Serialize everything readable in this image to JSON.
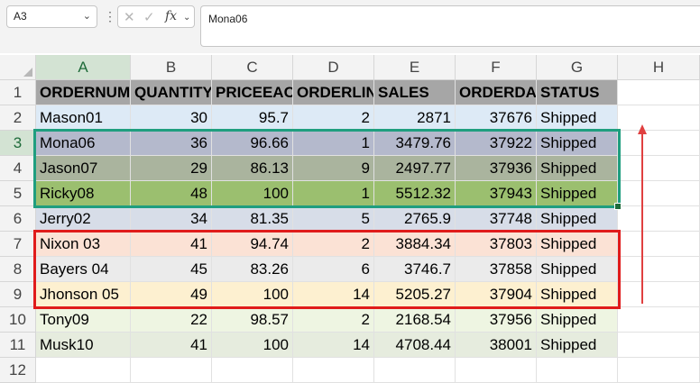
{
  "name_box": {
    "value": "A3"
  },
  "formula_bar": {
    "value": "Mona06",
    "fx_label": "fx"
  },
  "columns": [
    "A",
    "B",
    "C",
    "D",
    "E",
    "F",
    "G",
    "H"
  ],
  "rows": [
    "1",
    "2",
    "3",
    "4",
    "5",
    "6",
    "7",
    "8",
    "9",
    "10",
    "11",
    "12"
  ],
  "headers": [
    "ORDERNUM",
    "QUANTITY",
    "PRICEEAC",
    "ORDERLIN",
    "SALES",
    "ORDERDA",
    "STATUS"
  ],
  "data": [
    {
      "name": "Mason01",
      "qty": "30",
      "price": "95.7",
      "line": "2",
      "sales": "2871",
      "date": "37676",
      "status": "Shipped",
      "fill": "#ddeaf6"
    },
    {
      "name": "Mona06",
      "qty": "36",
      "price": "96.66",
      "line": "1",
      "sales": "3479.76",
      "date": "37922",
      "status": "Shipped",
      "fill": "#b4b9cc"
    },
    {
      "name": "Jason07",
      "qty": "29",
      "price": "86.13",
      "line": "9",
      "sales": "2497.77",
      "date": "37936",
      "status": "Shipped",
      "fill": "#aab49e"
    },
    {
      "name": "Ricky08",
      "qty": "48",
      "price": "100",
      "line": "1",
      "sales": "5512.32",
      "date": "37943",
      "status": "Shipped",
      "fill": "#9bbf6f"
    },
    {
      "name": "Jerry02",
      "qty": "34",
      "price": "81.35",
      "line": "5",
      "sales": "2765.9",
      "date": "37748",
      "status": "Shipped",
      "fill": "#d7dde8"
    },
    {
      "name": "Nixon 03",
      "qty": "41",
      "price": "94.74",
      "line": "2",
      "sales": "3884.34",
      "date": "37803",
      "status": "Shipped",
      "fill": "#fbe2d5"
    },
    {
      "name": "Bayers 04",
      "qty": "45",
      "price": "83.26",
      "line": "6",
      "sales": "3746.7",
      "date": "37858",
      "status": "Shipped",
      "fill": "#ebebeb"
    },
    {
      "name": "Jhonson 05",
      "qty": "49",
      "price": "100",
      "line": "14",
      "sales": "5205.27",
      "date": "37904",
      "status": "Shipped",
      "fill": "#fdf0d0"
    },
    {
      "name": "Tony09",
      "qty": "22",
      "price": "98.57",
      "line": "2",
      "sales": "2168.54",
      "date": "37956",
      "status": "Shipped",
      "fill": "#eef5e2"
    },
    {
      "name": "Musk10",
      "qty": "41",
      "price": "100",
      "line": "14",
      "sales": "4708.44",
      "date": "38001",
      "status": "Shipped",
      "fill": "#e6ecde"
    }
  ],
  "colors": {
    "header_fill": "#a6a6a6",
    "highlight_green": "#1f9e7f",
    "highlight_red": "#e01b1b",
    "arrow": "#e04040"
  }
}
